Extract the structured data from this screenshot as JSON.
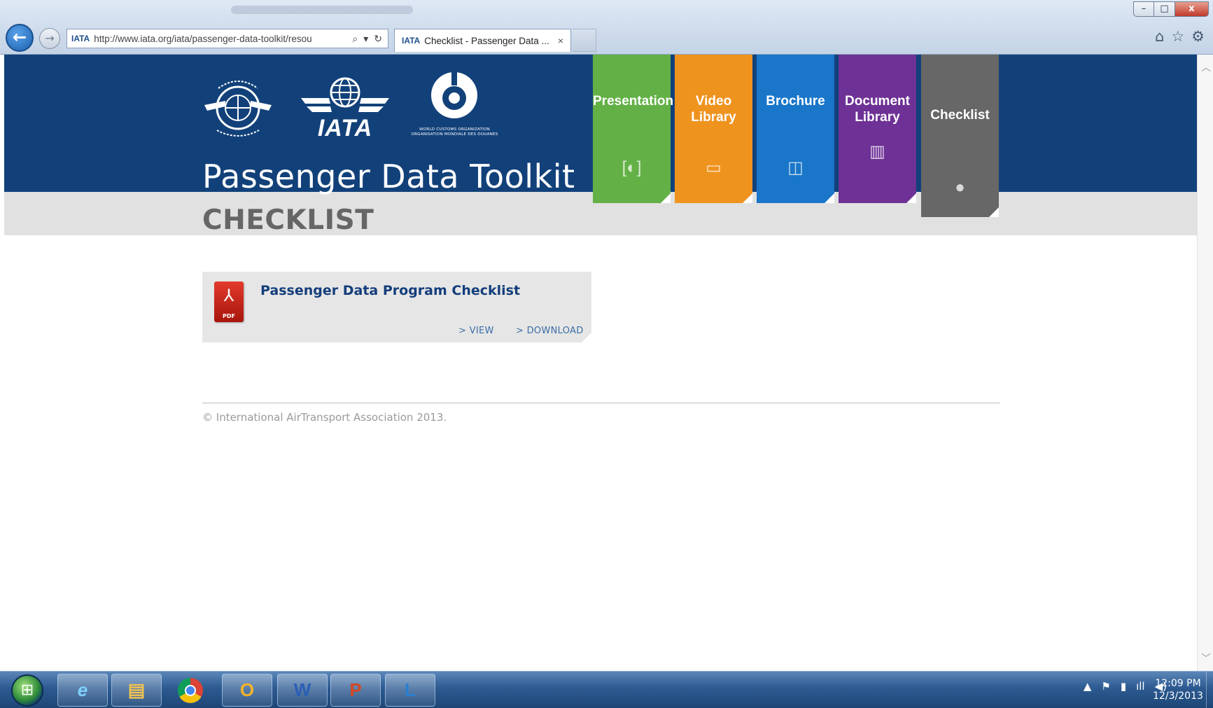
{
  "browser": {
    "url": "http://www.iata.org/iata/passenger-data-toolkit/resou",
    "tab_title": "Checklist - Passenger Data ...",
    "tab_close": "×",
    "back_glyph": "←",
    "forward_glyph": "→",
    "search_glyph": "⌕",
    "dropdown_glyph": "▾",
    "refresh_glyph": "↻",
    "site_glyph": "IATA",
    "window_controls": {
      "minimize": "–",
      "maximize": "□",
      "close": "x"
    },
    "toolbar_icons": {
      "home": "⌂",
      "favorites": "☆",
      "tools": "⚙"
    }
  },
  "header": {
    "logos": {
      "iata_word": "IATA",
      "wco_caption": "WORLD CUSTOMS ORGANIZATION ORGANISATION MONDIALE DES DOUANES"
    },
    "site_title": "Passenger Data Toolkit",
    "section_title": "CHECKLIST"
  },
  "nav": {
    "presentation": {
      "label": "Presentation",
      "icon": "[◐]",
      "color": "#63b146"
    },
    "video_library": {
      "label": "Video Library",
      "icon": "▭",
      "color": "#ef931f"
    },
    "brochure": {
      "label": "Brochure",
      "icon": "◫",
      "color": "#1976c9"
    },
    "document_library": {
      "label": "Document Library",
      "icon": "▥",
      "color": "#6e3196"
    },
    "checklist": {
      "label": "Checklist",
      "icon": "●",
      "color": "#676767"
    }
  },
  "document": {
    "icon_label": "PDF",
    "title": "Passenger Data Program Checklist",
    "view_label": "> VIEW",
    "download_label": "> DOWNLOAD"
  },
  "footer": {
    "copyright": "© International AirTransport Association 2013."
  },
  "taskbar": {
    "start_glyph": "⊞",
    "apps": {
      "ie": "e",
      "explorer": "▤",
      "outlook": "O",
      "word": "W",
      "powerpoint": "P",
      "lync": "L"
    },
    "tray_icons": {
      "show_hidden": "▲",
      "flag": "⚑",
      "network_power": "▮",
      "signal": "ıll",
      "volume": "◀)"
    },
    "time": "12:09 PM",
    "date": "12/3/2013"
  }
}
